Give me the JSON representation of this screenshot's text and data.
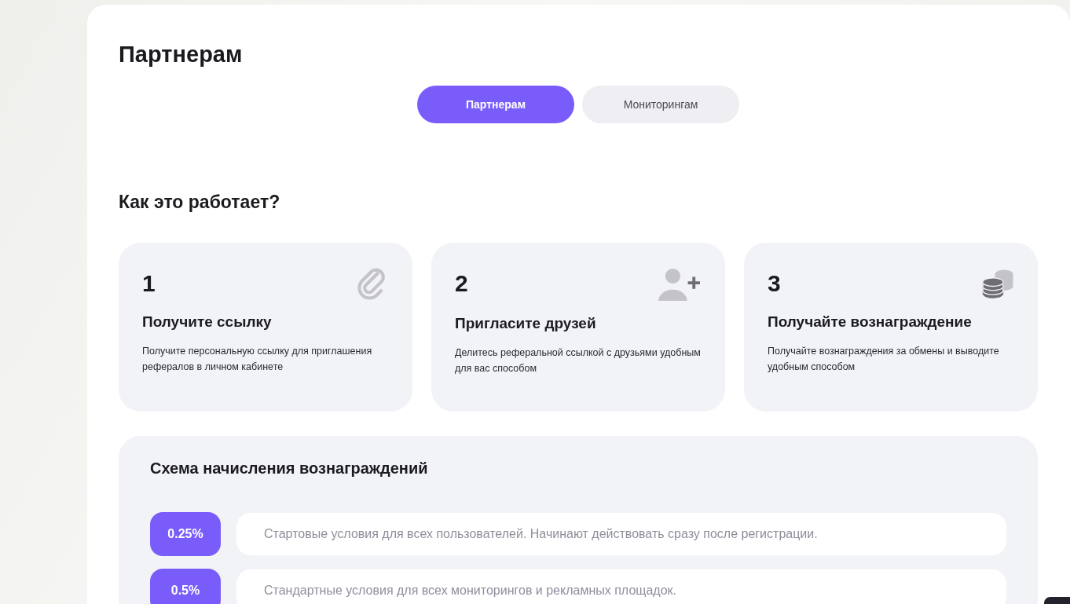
{
  "page_title": "Партнерам",
  "tabs": [
    {
      "label": "Партнерам",
      "selected": true
    },
    {
      "label": "Мониторингам",
      "selected": false
    }
  ],
  "how_it_works": {
    "title": "Как это работает?",
    "steps": [
      {
        "number": "1",
        "kind": "link",
        "title": "Получите ссылку",
        "text": "Получите персональную ссылку для приглашения рефералов в личном кабинете"
      },
      {
        "number": "2",
        "kind": "invite",
        "title": "Пригласите друзей",
        "text": "Делитесь реферальной ссылкой с друзьями удобным для вас способом"
      },
      {
        "number": "3",
        "kind": "reward",
        "title": "Получайте вознаграждение",
        "text": "Получайте вознаграждения за обмены и выводите удобным способом"
      }
    ]
  },
  "reward_scheme": {
    "title": "Схема начисления вознаграждений",
    "rows": [
      {
        "rate": "0.25%",
        "text": "Стартовые условия для всех пользователей. Начинают действовать сразу после регистрации."
      },
      {
        "rate": "0.5%",
        "text": "Стандартные условия для всех мониторингов и рекламных площадок."
      }
    ]
  }
}
